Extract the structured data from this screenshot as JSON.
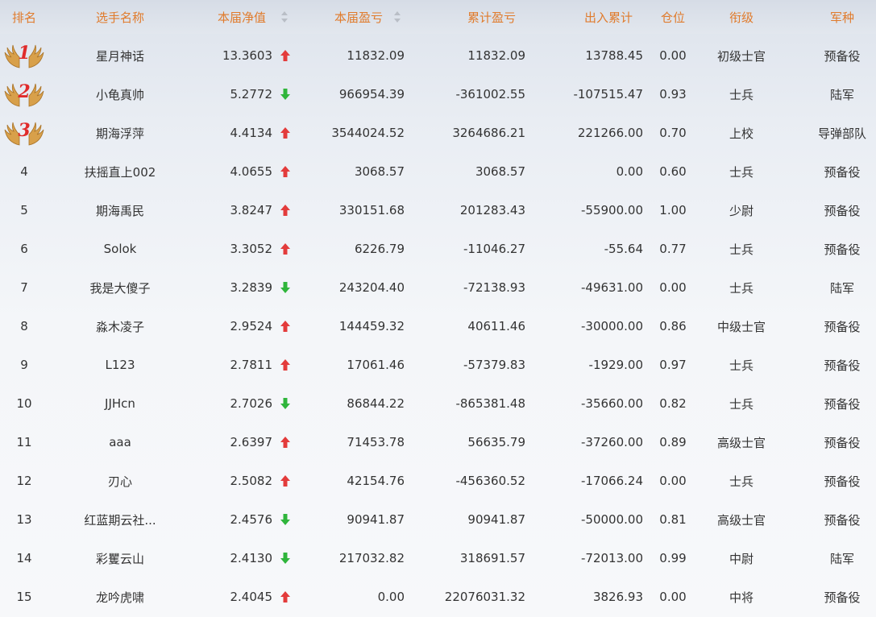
{
  "columns": {
    "rank": "排名",
    "name": "选手名称",
    "nav": "本届净值",
    "pnl": "本届盈亏",
    "cum_pnl": "累计盈亏",
    "flow": "出入累计",
    "position": "仓位",
    "military_rank": "衔级",
    "army": "军种"
  },
  "colors": {
    "header_text": "#e07b2c",
    "up": "#e33b3b",
    "down": "#2fb53b",
    "medal_number": "#e02b2b",
    "wing": "#d8a04a"
  },
  "rows": [
    {
      "rank": "1",
      "name": "星月神话",
      "nav": "13.3603",
      "trend": "up",
      "pnl": "11832.09",
      "cum_pnl": "11832.09",
      "flow": "13788.45",
      "position": "0.00",
      "military_rank": "初级士官",
      "army": "预备役"
    },
    {
      "rank": "2",
      "name": "小龟真帅",
      "nav": "5.2772",
      "trend": "down",
      "pnl": "966954.39",
      "cum_pnl": "-361002.55",
      "flow": "-107515.47",
      "position": "0.93",
      "military_rank": "士兵",
      "army": "陆军"
    },
    {
      "rank": "3",
      "name": "期海浮萍",
      "nav": "4.4134",
      "trend": "up",
      "pnl": "3544024.52",
      "cum_pnl": "3264686.21",
      "flow": "221266.00",
      "position": "0.70",
      "military_rank": "上校",
      "army": "导弹部队"
    },
    {
      "rank": "4",
      "name": "扶摇直上002",
      "nav": "4.0655",
      "trend": "up",
      "pnl": "3068.57",
      "cum_pnl": "3068.57",
      "flow": "0.00",
      "position": "0.60",
      "military_rank": "士兵",
      "army": "预备役"
    },
    {
      "rank": "5",
      "name": "期海禹民",
      "nav": "3.8247",
      "trend": "up",
      "pnl": "330151.68",
      "cum_pnl": "201283.43",
      "flow": "-55900.00",
      "position": "1.00",
      "military_rank": "少尉",
      "army": "预备役"
    },
    {
      "rank": "6",
      "name": "Solok",
      "nav": "3.3052",
      "trend": "up",
      "pnl": "6226.79",
      "cum_pnl": "-11046.27",
      "flow": "-55.64",
      "position": "0.77",
      "military_rank": "士兵",
      "army": "预备役"
    },
    {
      "rank": "7",
      "name": "我是大傻子",
      "nav": "3.2839",
      "trend": "down",
      "pnl": "243204.40",
      "cum_pnl": "-72138.93",
      "flow": "-49631.00",
      "position": "0.00",
      "military_rank": "士兵",
      "army": "陆军"
    },
    {
      "rank": "8",
      "name": "淼木凌子",
      "nav": "2.9524",
      "trend": "up",
      "pnl": "144459.32",
      "cum_pnl": "40611.46",
      "flow": "-30000.00",
      "position": "0.86",
      "military_rank": "中级士官",
      "army": "预备役"
    },
    {
      "rank": "9",
      "name": "L123",
      "nav": "2.7811",
      "trend": "up",
      "pnl": "17061.46",
      "cum_pnl": "-57379.83",
      "flow": "-1929.00",
      "position": "0.97",
      "military_rank": "士兵",
      "army": "预备役"
    },
    {
      "rank": "10",
      "name": "JJHcn",
      "nav": "2.7026",
      "trend": "down",
      "pnl": "86844.22",
      "cum_pnl": "-865381.48",
      "flow": "-35660.00",
      "position": "0.82",
      "military_rank": "士兵",
      "army": "预备役"
    },
    {
      "rank": "11",
      "name": "aaa",
      "nav": "2.6397",
      "trend": "up",
      "pnl": "71453.78",
      "cum_pnl": "56635.79",
      "flow": "-37260.00",
      "position": "0.89",
      "military_rank": "高级士官",
      "army": "预备役"
    },
    {
      "rank": "12",
      "name": "刃心",
      "nav": "2.5082",
      "trend": "up",
      "pnl": "42154.76",
      "cum_pnl": "-456360.52",
      "flow": "-17066.24",
      "position": "0.00",
      "military_rank": "士兵",
      "army": "预备役"
    },
    {
      "rank": "13",
      "name": "红蓝期云社...",
      "nav": "2.4576",
      "trend": "down",
      "pnl": "90941.87",
      "cum_pnl": "90941.87",
      "flow": "-50000.00",
      "position": "0.81",
      "military_rank": "高级士官",
      "army": "预备役"
    },
    {
      "rank": "14",
      "name": "彩矍云山",
      "nav": "2.4130",
      "trend": "down",
      "pnl": "217032.82",
      "cum_pnl": "318691.57",
      "flow": "-72013.00",
      "position": "0.99",
      "military_rank": "中尉",
      "army": "陆军"
    },
    {
      "rank": "15",
      "name": "龙吟虎啸",
      "nav": "2.4045",
      "trend": "up",
      "pnl": "0.00",
      "cum_pnl": "22076031.32",
      "flow": "3826.93",
      "position": "0.00",
      "military_rank": "中将",
      "army": "预备役"
    }
  ]
}
